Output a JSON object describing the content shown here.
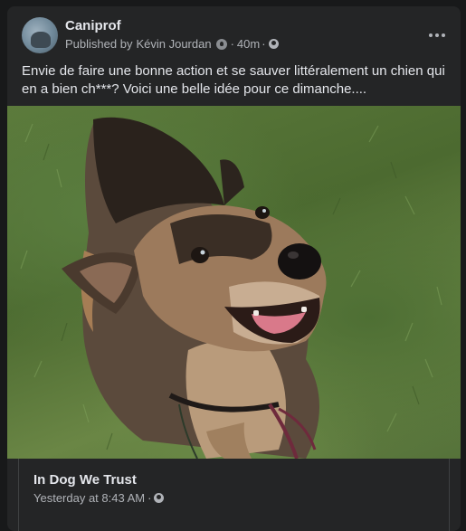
{
  "post": {
    "page_name": "Caniprof",
    "published_by_prefix": "Published by",
    "author": "Kévin Jourdan",
    "separator": "·",
    "time": "40m",
    "text": "Envie de faire une bonne action et se sauver littéralement un chien qui en a bien ch***? Voici une belle idée pour ce dimanche....",
    "avatar_icon": "dog-avatar",
    "more_icon": "more-horizontal-icon",
    "audience_icon": "globe-icon"
  },
  "photo": {
    "subject": "dog-photo"
  },
  "link_preview": {
    "title": "In Dog We Trust",
    "time": "Yesterday at 8:43 AM",
    "separator": "·"
  },
  "colors": {
    "background": "#18191a",
    "card": "#242526",
    "primary_text": "#e4e6eb",
    "secondary_text": "#b0b3b8"
  }
}
